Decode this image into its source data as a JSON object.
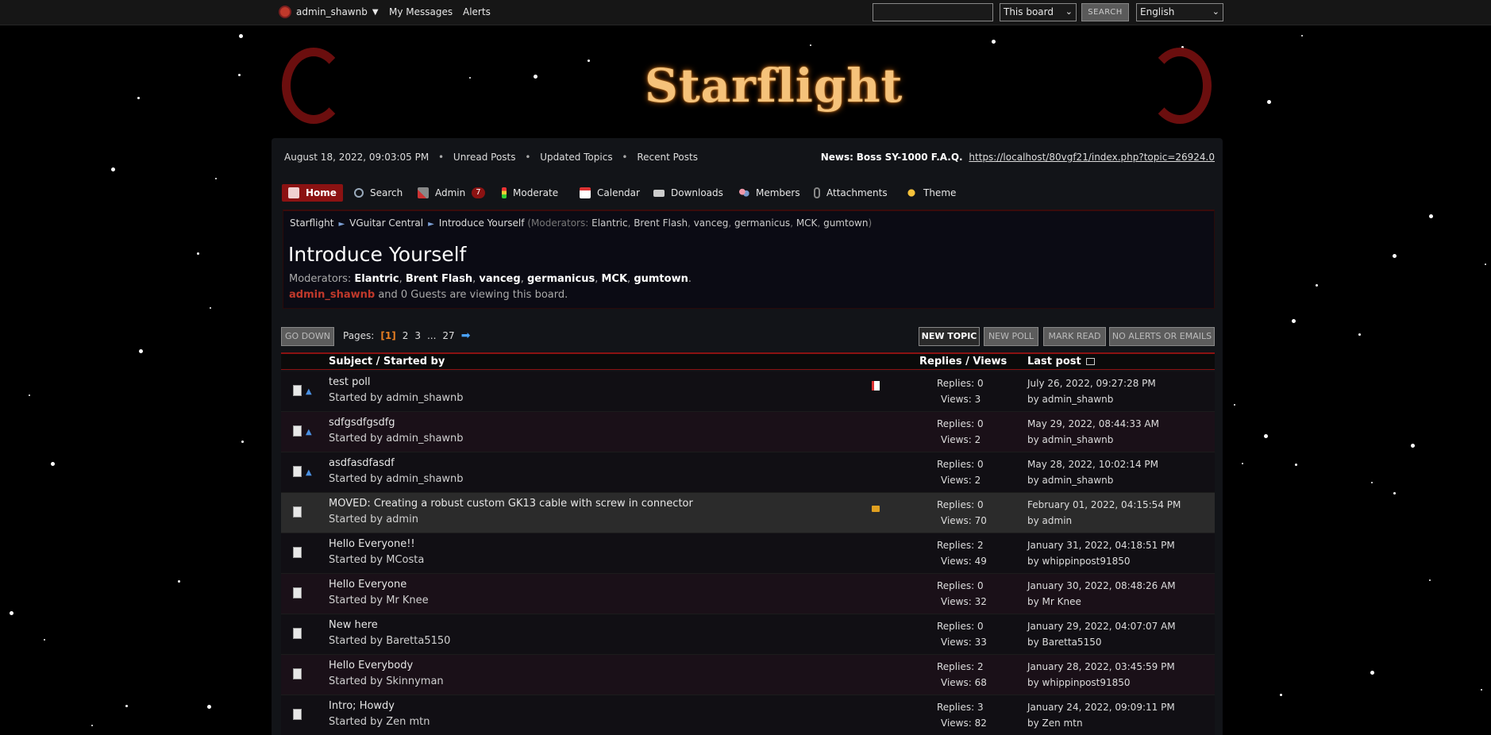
{
  "topbar": {
    "user": "admin_shawnb",
    "user_caret": "▼",
    "links": [
      "My Messages",
      "Alerts"
    ],
    "search_placeholder": "",
    "scope": "This board",
    "search_button": "SEARCH",
    "language": "English"
  },
  "header": {
    "logo": "Starflight"
  },
  "info": {
    "datetime": "August 18, 2022, 09:03:05 PM",
    "links": [
      "Unread Posts",
      "Updated Topics",
      "Recent Posts"
    ],
    "news_label": "News:",
    "news_title": "Boss SY-1000 F.A.Q.",
    "news_url": "https://localhost/80vgf21/index.php?topic=26924.0"
  },
  "menu": [
    {
      "label": "Home",
      "icon": "home-icon"
    },
    {
      "label": "Search",
      "icon": "search-icon"
    },
    {
      "label": "Admin",
      "icon": "admin-tools-icon",
      "badge": "7"
    },
    {
      "label": "Moderate",
      "icon": "traffic-light-icon"
    },
    {
      "label": "Calendar",
      "icon": "calendar-icon"
    },
    {
      "label": "Downloads",
      "icon": "downloads-icon"
    },
    {
      "label": "Members",
      "icon": "members-icon"
    },
    {
      "label": "Attachments",
      "icon": "paperclip-icon"
    },
    {
      "label": "Theme",
      "icon": "theme-icon"
    }
  ],
  "breadcrumb": {
    "items": [
      "Starflight",
      "VGuitar Central",
      "Introduce Yourself"
    ],
    "mods_label": "(Moderators:",
    "mods": [
      "Elantric",
      "Brent Flash",
      "vanceg",
      "germanicus",
      "MCK",
      "gumtown"
    ],
    "mods_close": ")"
  },
  "board": {
    "title": "Introduce Yourself",
    "moderators_label": "Moderators:",
    "moderators": [
      "Elantric",
      "Brent Flash",
      "vanceg",
      "germanicus",
      "MCK",
      "gumtown"
    ],
    "viewer_user": "admin_shawnb",
    "viewers_text": "and 0 Guests are viewing this board."
  },
  "pagination": {
    "go_down": "GO DOWN",
    "label": "Pages:",
    "current": "[1]",
    "pages": [
      "2",
      "3",
      "...",
      "27"
    ],
    "next_icon": "➡"
  },
  "actions": [
    "NEW TOPIC",
    "NEW POLL",
    "MARK READ",
    "NO ALERTS OR EMAILS"
  ],
  "table": {
    "col_subject": "Subject / Started by",
    "col_replies": "Replies / Views",
    "col_lastpost": "Last post",
    "rows": [
      {
        "subject": "test poll",
        "started": "Started by admin_shawnb",
        "replies": "Replies: 0",
        "views": "Views: 3",
        "last": "July 26, 2022, 09:27:28 PM",
        "by": "by admin_shawnb",
        "icon": "poll-icon",
        "flag": "poll"
      },
      {
        "subject": "sdfgsdfgsdfg",
        "started": "Started by admin_shawnb",
        "replies": "Replies: 0",
        "views": "Views: 2",
        "last": "May 29, 2022, 08:44:33 AM",
        "by": "by admin_shawnb",
        "icon": "post-icon",
        "flag": ""
      },
      {
        "subject": "asdfasdfasdf",
        "started": "Started by admin_shawnb",
        "replies": "Replies: 0",
        "views": "Views: 2",
        "last": "May 28, 2022, 10:02:14 PM",
        "by": "by admin_shawnb",
        "icon": "thumbs-up-icon",
        "flag": ""
      },
      {
        "subject": "MOVED: Creating a robust custom GK13 cable with screw in connector",
        "started": "Started by admin",
        "replies": "Replies: 0",
        "views": "Views: 70",
        "last": "February 01, 2022, 04:15:54 PM",
        "by": "by admin",
        "icon": "moved-icon",
        "flag": "lock"
      },
      {
        "subject": "Hello Everyone!!",
        "started": "Started by MCosta",
        "replies": "Replies: 2",
        "views": "Views: 49",
        "last": "January 31, 2022, 04:18:51 PM",
        "by": "by whippinpost91850",
        "icon": "post-icon",
        "flag": ""
      },
      {
        "subject": "Hello Everyone",
        "started": "Started by Mr Knee",
        "replies": "Replies: 0",
        "views": "Views: 32",
        "last": "January 30, 2022, 08:48:26 AM",
        "by": "by Mr Knee",
        "icon": "post-icon",
        "flag": ""
      },
      {
        "subject": "New here",
        "started": "Started by Baretta5150",
        "replies": "Replies: 0",
        "views": "Views: 33",
        "last": "January 29, 2022, 04:07:07 AM",
        "by": "by Baretta5150",
        "icon": "post-icon",
        "flag": ""
      },
      {
        "subject": "Hello Everybody",
        "started": "Started by Skinnyman",
        "replies": "Replies: 2",
        "views": "Views: 68",
        "last": "January 28, 2022, 03:45:59 PM",
        "by": "by whippinpost91850",
        "icon": "post-icon",
        "flag": ""
      },
      {
        "subject": "Intro; Howdy",
        "started": "Started by Zen mtn",
        "replies": "Replies: 3",
        "views": "Views: 82",
        "last": "January 24, 2022, 09:09:11 PM",
        "by": "by Zen mtn",
        "icon": "post-icon",
        "flag": ""
      }
    ]
  },
  "colors": {
    "accent": "#8b1212",
    "logo": "#f5c27a",
    "user": "#c0392b",
    "page_current": "#e67e22"
  }
}
